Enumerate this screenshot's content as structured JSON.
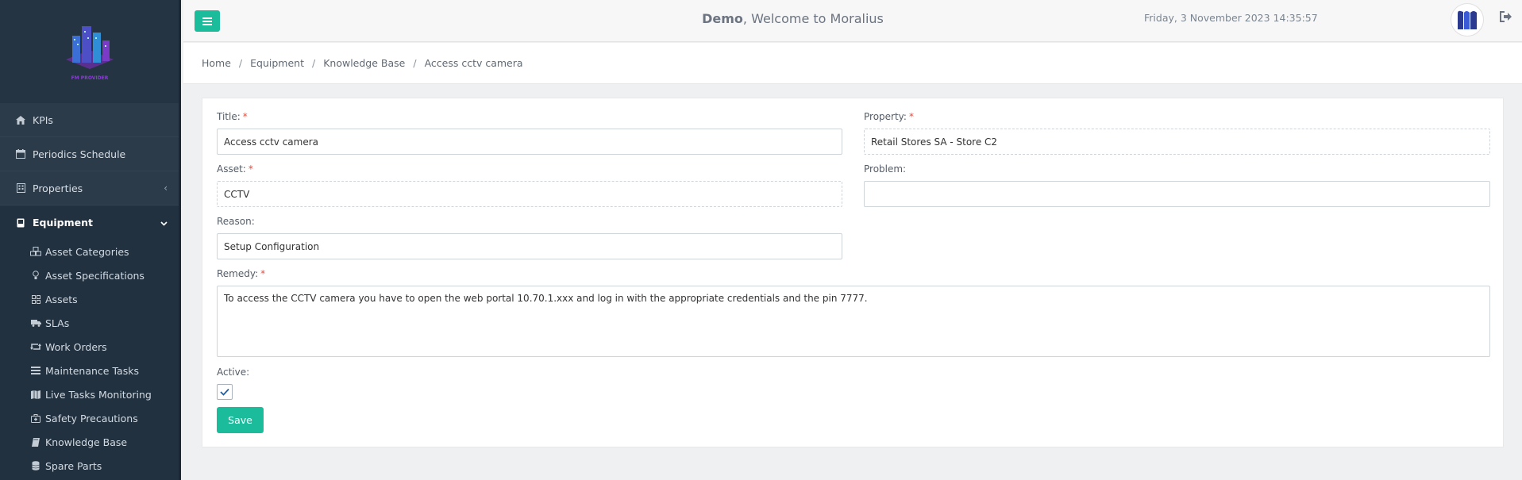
{
  "header": {
    "user": "Demo",
    "welcome": ", Welcome to Moralius",
    "datetime": "Friday, 3 November 2023 14:35:57"
  },
  "logo": {
    "text": "FM PROVIDER"
  },
  "sidebar": {
    "items": [
      {
        "label": "KPIs",
        "icon": "home-icon"
      },
      {
        "label": "Periodics Schedule",
        "icon": "calendar-icon"
      },
      {
        "label": "Properties",
        "icon": "building-icon"
      },
      {
        "label": "Equipment",
        "icon": "device-icon"
      }
    ],
    "equipment_submenu": [
      {
        "label": "Asset Categories",
        "icon": "cubes-icon"
      },
      {
        "label": "Asset Specifications",
        "icon": "lightbulb-icon"
      },
      {
        "label": "Assets",
        "icon": "grid-icon"
      },
      {
        "label": "SLAs",
        "icon": "truck-icon"
      },
      {
        "label": "Work Orders",
        "icon": "retweet-icon"
      },
      {
        "label": "Maintenance Tasks",
        "icon": "list-icon"
      },
      {
        "label": "Live Tasks Monitoring",
        "icon": "map-icon"
      },
      {
        "label": "Safety Precautions",
        "icon": "medkit-icon"
      },
      {
        "label": "Knowledge Base",
        "icon": "book-icon"
      },
      {
        "label": "Spare Parts",
        "icon": "database-icon"
      }
    ]
  },
  "breadcrumb": [
    "Home",
    "Equipment",
    "Knowledge Base",
    "Access cctv camera"
  ],
  "form": {
    "title_label": "Title:",
    "title_value": "Access cctv camera",
    "property_label": "Property:",
    "property_value": "Retail Stores SA - Store C2",
    "asset_label": "Asset:",
    "asset_value": "CCTV",
    "problem_label": "Problem:",
    "problem_value": "",
    "reason_label": "Reason:",
    "reason_value": "Setup Configuration",
    "remedy_label": "Remedy:",
    "remedy_value": "To access the CCTV camera you have to open the web portal 10.70.1.xxx and log in with the appropriate credentials and the pin 7777.",
    "active_label": "Active:",
    "active_checked": true,
    "save_label": "Save",
    "required_mark": "*"
  },
  "colors": {
    "accent": "#1abc9c",
    "sidebar_bg": "#2c3b4a",
    "required": "#e74c3c"
  }
}
